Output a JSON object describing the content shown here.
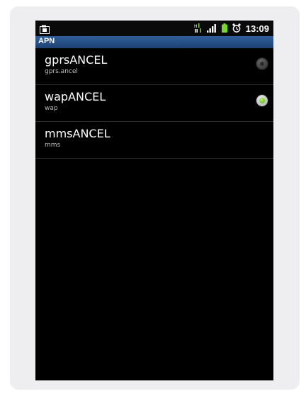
{
  "statusbar": {
    "time": "13:09",
    "icons": [
      "screenshot-icon",
      "network-type-icon",
      "signal-bars-icon",
      "battery-icon",
      "alarm-icon"
    ],
    "battery_color": "#7ad82a"
  },
  "title": "APN",
  "apns": [
    {
      "name": "gprsANCEL",
      "apn": "gprs.ancel",
      "selected": false
    },
    {
      "name": "wapANCEL",
      "apn": "wap",
      "selected": true
    },
    {
      "name": "mmsANCEL",
      "apn": "mms",
      "selected": null
    }
  ],
  "colors": {
    "titlebar": "#2a5590",
    "device_edge": "#2f8ccc",
    "radio_selected": "#7ad82a"
  }
}
